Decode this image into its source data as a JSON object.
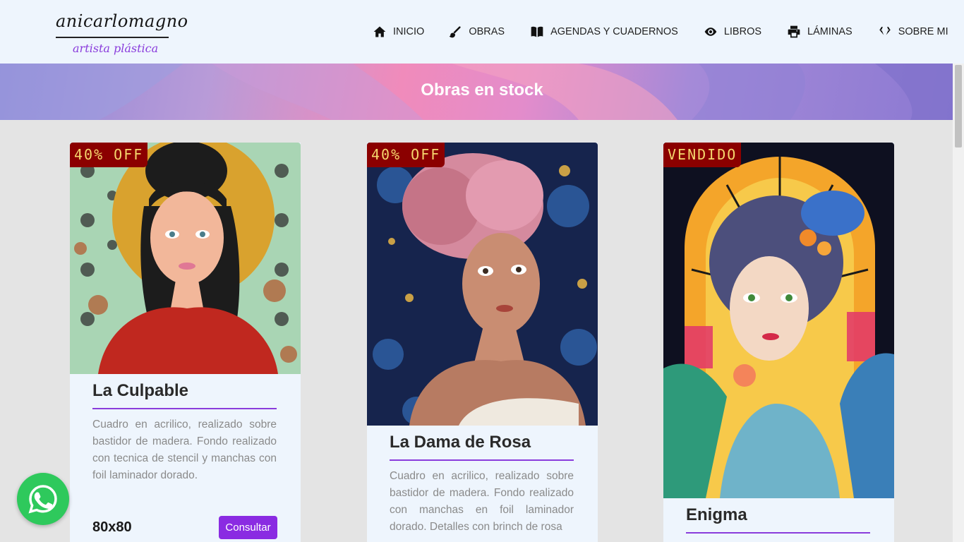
{
  "header": {
    "logo_main": "anicarlomagno",
    "logo_sub": "artista plástica",
    "nav": [
      {
        "label": "INICIO",
        "icon": "home-icon"
      },
      {
        "label": "OBRAS",
        "icon": "paintbrush-icon"
      },
      {
        "label": "AGENDAS Y CUADERNOS",
        "icon": "book-icon"
      },
      {
        "label": "LIBROS",
        "icon": "eye-icon"
      },
      {
        "label": "LÁMINAS",
        "icon": "printer-icon"
      },
      {
        "label": "SOBRE MI",
        "icon": "gem-icon"
      }
    ]
  },
  "banner": {
    "title": "Obras en stock"
  },
  "cards": [
    {
      "badge": "40% OFF",
      "title": "La Culpable",
      "description": "Cuadro en acrilico, realizado sobre bastidor de madera. Fondo realizado con tecnica de stencil y manchas con foil laminador dorado.",
      "size": "80x80",
      "button": "Consultar"
    },
    {
      "badge": "40% OFF",
      "title": "La Dama de Rosa",
      "description": "Cuadro en acrilico, realizado sobre bastidor de madera. Fondo realizado con manchas en foil laminador dorado. Detalles con brinch de rosa"
    },
    {
      "badge": "VENDIDO",
      "title": "Enigma"
    }
  ],
  "colors": {
    "accent": "#8a2be2",
    "badge_bg": "#8b0000",
    "badge_text": "#f5d76e",
    "header_bg": "#eef5fd",
    "whatsapp": "#2ec95c"
  }
}
